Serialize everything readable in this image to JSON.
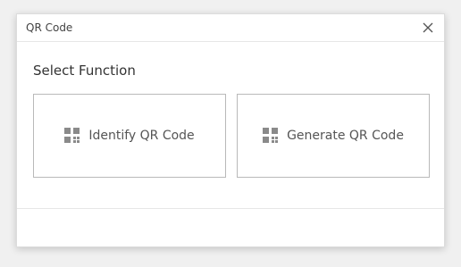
{
  "dialog": {
    "title": "QR Code",
    "heading": "Select Function",
    "options": [
      {
        "label": "Identify QR Code",
        "icon": "qr-code-icon"
      },
      {
        "label": "Generate QR Code",
        "icon": "qr-code-icon"
      }
    ]
  },
  "colors": {
    "icon": "#8a8a8a"
  }
}
